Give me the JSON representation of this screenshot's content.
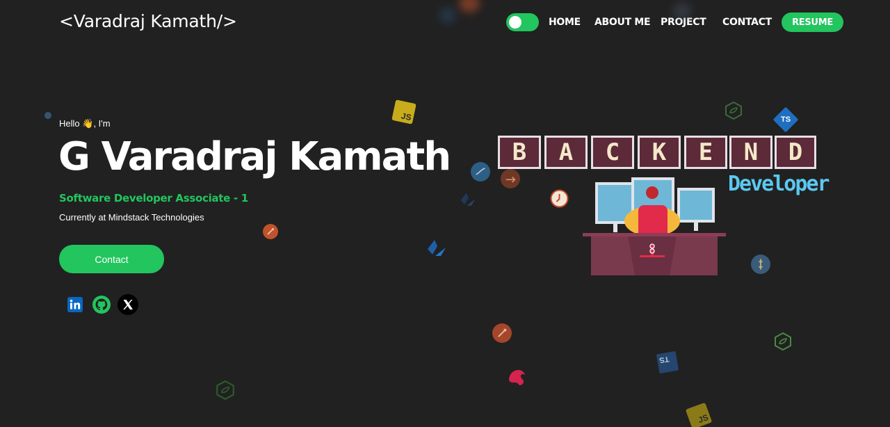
{
  "header": {
    "logo": "<Varadraj Kamath/>",
    "nav": [
      "HOME",
      "ABOUT ME",
      "PROJECT",
      "CONTACT"
    ],
    "resume_label": "RESUME",
    "theme_toggle": "dark-mode-toggle"
  },
  "hero": {
    "greeting_prefix": "Hello",
    "greeting_suffix": ", I'm",
    "name": "G Varadraj Kamath",
    "role": "Software Developer Associate - 1",
    "company": "Currently at Mindstack Technologies",
    "contact_label": "Contact",
    "social": [
      "linkedin-icon",
      "github-icon",
      "x-icon"
    ]
  },
  "illustration": {
    "letters": [
      "B",
      "A",
      "C",
      "K",
      "E",
      "N",
      "D"
    ],
    "subtitle": "Developer"
  },
  "floating_badges": {
    "js": "JS",
    "ts": "TS"
  },
  "colors": {
    "background": "#212121",
    "accent": "#22c55e",
    "developer_text": "#5bc8f0"
  }
}
